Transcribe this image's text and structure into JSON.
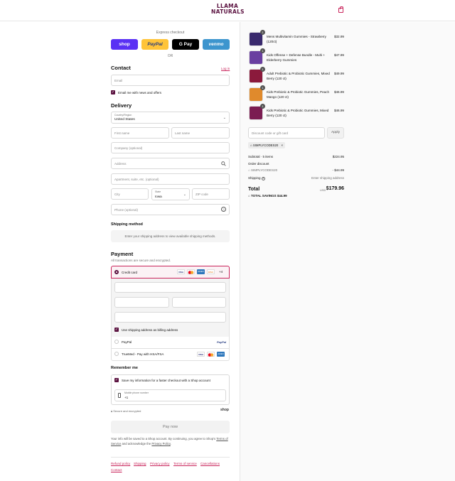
{
  "brand": {
    "logo_line1": "LLAMA",
    "logo_line2": "NATURALS"
  },
  "icons": {
    "bag": "shopping-bag-icon",
    "search": "search-icon",
    "help": "help-circle-icon",
    "tag": "tag-icon",
    "lock": "lock-icon",
    "phone": "phone-icon",
    "chevron": "chevron-down-icon",
    "close": "close-icon"
  },
  "express": {
    "title": "Express checkout",
    "buttons": [
      {
        "label": "shop",
        "color": "#5a31f4",
        "text_color": "#ffffff"
      },
      {
        "label": "PayPal",
        "color": "#ffc439",
        "text_color": "#253b80"
      },
      {
        "label": "G Pay",
        "color": "#000000",
        "text_color": "#ffffff"
      },
      {
        "label": "venmo",
        "color": "#3d95ce",
        "text_color": "#ffffff"
      }
    ],
    "or": "OR"
  },
  "contact": {
    "title": "Contact",
    "login": "Log in",
    "email_placeholder": "Email",
    "newsletter_label": "Email me with news and offers"
  },
  "delivery": {
    "title": "Delivery",
    "country_label": "Country/Region",
    "country_value": "United States",
    "first_name": "First name",
    "last_name": "Last name",
    "company": "Company (optional)",
    "address": "Address",
    "apartment": "Apartment, suite, etc. (optional)",
    "city": "City",
    "state_label": "State",
    "state_value": "Iowa",
    "zip": "ZIP code",
    "phone": "Phone (optional)"
  },
  "shipping": {
    "title": "Shipping method",
    "message": "Enter your shipping address to view available shipping methods."
  },
  "payment": {
    "title": "Payment",
    "subtitle": "All transactions are secure and encrypted.",
    "credit_card": "Credit card",
    "card_brands": [
      "VISA",
      "MC",
      "AMEX",
      "DISC"
    ],
    "more_cards": "+4",
    "billing_label": "Use shipping address as billing address",
    "paypal": "PayPal",
    "paypal_logo": "PayPal",
    "truemed": "TrueMed - Pay with HSA/FSA"
  },
  "remember": {
    "title": "Remember me",
    "save_label": "Save my information for a faster checkout with a Shop account",
    "mobile_label": "Mobile phone number",
    "mobile_value": "+1",
    "secure": "Secure and encrypted",
    "shop": "shop"
  },
  "pay_now": "Pay now",
  "legal": {
    "line1": "Your info will be saved to a Shop account. By continuing, you agree to Shop's",
    "terms": "Terms of Service",
    "and": "and acknowledge the",
    "privacy": "Privacy Policy",
    "period": "."
  },
  "footer": [
    "Refund policy",
    "Shipping",
    "Privacy policy",
    "Terms of service",
    "Cancellations",
    "Contact"
  ],
  "cart": {
    "items": [
      {
        "name": "Mens Multivitamin Gummies - Strawberry (120ct)",
        "price": "$32.99",
        "qty": "1",
        "color": "#3a2a6e"
      },
      {
        "name": "Kids Offense + Defense Bundle - Multi + Elderberry Gummies",
        "price": "$47.99",
        "qty": "1",
        "color": "#6a3fa0"
      },
      {
        "name": "Adult Prebiotic & Probiotic Gummies, Mixed Berry (120 ct)",
        "price": "$49.99",
        "qty": "1",
        "color": "#8b1a3c"
      },
      {
        "name": "Kids Prebiotic & Probiotic Gummies, Peach Mango (120 ct)",
        "price": "$46.99",
        "qty": "1",
        "color": "#e08a2c"
      },
      {
        "name": "Kids Prebiotic & Probiotic Gummies, Mixed Berry (120 ct)",
        "price": "$46.99",
        "qty": "1",
        "color": "#7b1d52"
      }
    ],
    "discount_placeholder": "Discount code or gift card",
    "apply": "Apply",
    "code": "SIMPLYCODES20",
    "subtotal_label": "Subtotal · 5 items",
    "subtotal": "$224.95",
    "order_discount": "Order discount",
    "discount_code": "SIMPLYCODES20",
    "discount_value": "- $44.99",
    "shipping_label": "Shipping",
    "shipping_value": "Enter shipping address",
    "total_label": "Total",
    "currency": "USD",
    "total": "$179.96",
    "savings_label": "TOTAL SAVINGS",
    "savings": "$44.99"
  }
}
